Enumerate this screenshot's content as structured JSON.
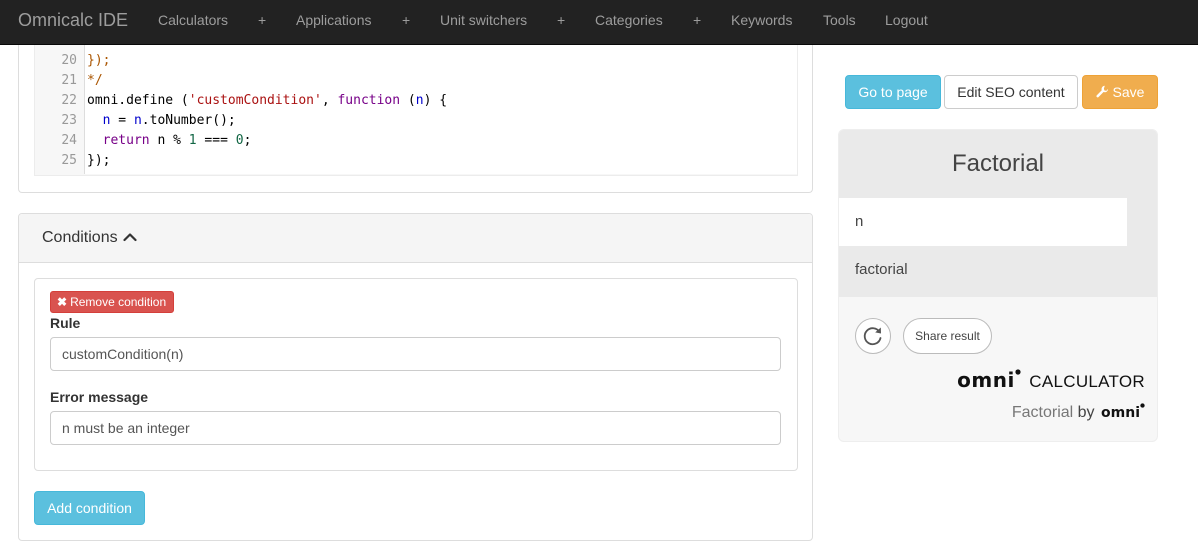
{
  "navbar": {
    "brand": "Omnicalc IDE",
    "items": [
      "Calculators",
      "+",
      "Applications",
      "+",
      "Unit switchers",
      "+",
      "Categories",
      "+",
      "Keywords",
      "Tools",
      "Logout"
    ]
  },
  "code": {
    "line_numbers": [
      "20",
      "21",
      "22",
      "23",
      "24",
      "25"
    ],
    "lines": [
      [
        {
          "t": "});",
          "c": "comment"
        }
      ],
      [
        {
          "t": "*/",
          "c": "comment"
        }
      ],
      [
        {
          "t": "omni.define (",
          "c": "plain"
        },
        {
          "t": "'customCondition'",
          "c": "str"
        },
        {
          "t": ", ",
          "c": "plain"
        },
        {
          "t": "function",
          "c": "kw"
        },
        {
          "t": " (",
          "c": "plain"
        },
        {
          "t": "n",
          "c": "var"
        },
        {
          "t": ") {",
          "c": "plain"
        }
      ],
      [
        {
          "t": "  ",
          "c": "plain"
        },
        {
          "t": "n",
          "c": "var"
        },
        {
          "t": " = ",
          "c": "plain"
        },
        {
          "t": "n",
          "c": "var"
        },
        {
          "t": ".toNumber();",
          "c": "plain"
        }
      ],
      [
        {
          "t": "  ",
          "c": "plain"
        },
        {
          "t": "return",
          "c": "kw"
        },
        {
          "t": " n % ",
          "c": "plain"
        },
        {
          "t": "1",
          "c": "num"
        },
        {
          "t": " === ",
          "c": "plain"
        },
        {
          "t": "0",
          "c": "num"
        },
        {
          "t": ";",
          "c": "plain"
        }
      ],
      [
        {
          "t": "});",
          "c": "plain"
        }
      ]
    ]
  },
  "conditions": {
    "title": "Conditions",
    "remove_label": "Remove condition",
    "rule_label": "Rule",
    "rule_value": "customCondition(n)",
    "error_label": "Error message",
    "error_value": "n must be an integer",
    "add_label": "Add condition"
  },
  "actions": {
    "goto": "Go to page",
    "seo": "Edit SEO content",
    "save": "Save"
  },
  "calculator": {
    "title": "Factorial",
    "var_n": "n",
    "var_factorial": "factorial",
    "share": "Share result",
    "logo_omni": "omni",
    "logo_calculator": "CALCULATOR",
    "byline_name": "Factorial",
    "byline_by": "by",
    "byline_omni": "omni"
  },
  "colors": {
    "navbar_bg": "#222222",
    "info": "#5bc0de",
    "danger": "#d9534f",
    "warning": "#f0ad4e"
  },
  "icons": [
    "chevron-up-icon",
    "remove-x-icon",
    "wrench-icon",
    "reload-icon"
  ]
}
